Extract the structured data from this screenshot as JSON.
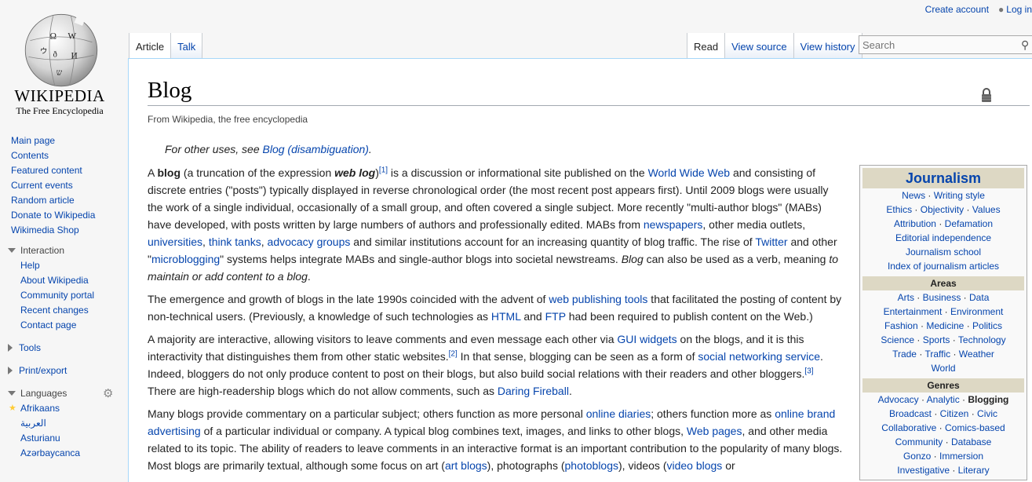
{
  "logo": {
    "wordmark": "WIKIPEDIA",
    "tagline": "The Free Encyclopedia"
  },
  "personal": {
    "create_account": "Create account",
    "login": "Log in"
  },
  "nav": {
    "main": [
      "Main page",
      "Contents",
      "Featured content",
      "Current events",
      "Random article",
      "Donate to Wikipedia",
      "Wikimedia Shop"
    ],
    "interaction_label": "Interaction",
    "interaction": [
      "Help",
      "About Wikipedia",
      "Community portal",
      "Recent changes",
      "Contact page"
    ],
    "tools_label": "Tools",
    "print_label": "Print/export",
    "languages_label": "Languages",
    "languages": [
      "Afrikaans",
      "العربية",
      "Asturianu",
      "Azərbaycanca"
    ]
  },
  "tabs": {
    "article": "Article",
    "talk": "Talk",
    "read": "Read",
    "view_source": "View source",
    "view_history": "View history"
  },
  "search": {
    "placeholder": "Search"
  },
  "article": {
    "title": "Blog",
    "from": "From Wikipedia, the free encyclopedia",
    "hatnote_pre": "For other uses, see ",
    "hatnote_link": "Blog (disambiguation)",
    "hatnote_post": "."
  },
  "infobox": {
    "title": "Journalism",
    "rows1": [
      [
        "News",
        "Writing style"
      ],
      [
        "Ethics",
        "Objectivity",
        "Values"
      ],
      [
        "Attribution",
        "Defamation"
      ],
      [
        "Editorial independence"
      ],
      [
        "Journalism school"
      ],
      [
        "Index of journalism articles"
      ]
    ],
    "areas_label": "Areas",
    "rows2": [
      [
        "Arts",
        "Business",
        "Data"
      ],
      [
        "Entertainment",
        "Environment"
      ],
      [
        "Fashion",
        "Medicine",
        "Politics"
      ],
      [
        "Science",
        "Sports",
        "Technology"
      ],
      [
        "Trade",
        "Traffic",
        "Weather"
      ],
      [
        "World"
      ]
    ],
    "genres_label": "Genres",
    "rows3": [
      [
        "Advocacy",
        "Analytic",
        "Blogging"
      ],
      [
        "Broadcast",
        "Citizen",
        "Civic"
      ],
      [
        "Collaborative",
        "Comics-based"
      ],
      [
        "Community",
        "Database"
      ],
      [
        "Gonzo",
        "Immersion"
      ],
      [
        "Investigative",
        "Literary"
      ]
    ],
    "current": "Blogging"
  },
  "paragraphs": [
    [
      {
        "t": "A "
      },
      {
        "t": "blog",
        "b": true
      },
      {
        "t": " (a truncation of the expression "
      },
      {
        "t": "web log",
        "b": true,
        "i": true
      },
      {
        "t": ")"
      },
      {
        "t": "[1]",
        "sup": true,
        "link": true
      },
      {
        "t": " is a discussion or informational site published on the "
      },
      {
        "t": "World Wide Web",
        "link": true
      },
      {
        "t": " and consisting of discrete entries (\"posts\") typically displayed in reverse chronological order (the most recent post appears first). Until 2009 blogs were usually the work of a single individual, occasionally of a small group, and often covered a single subject. More recently \"multi-author blogs\" (MABs) have developed, with posts written by large numbers of authors and professionally edited. MABs from "
      },
      {
        "t": "newspapers",
        "link": true
      },
      {
        "t": ", other media outlets, "
      },
      {
        "t": "universities",
        "link": true
      },
      {
        "t": ", "
      },
      {
        "t": "think tanks",
        "link": true
      },
      {
        "t": ", "
      },
      {
        "t": "advocacy groups",
        "link": true
      },
      {
        "t": " and similar institutions account for an increasing quantity of blog traffic. The rise of "
      },
      {
        "t": "Twitter",
        "link": true
      },
      {
        "t": " and other \""
      },
      {
        "t": "microblogging",
        "link": true
      },
      {
        "t": "\" systems helps integrate MABs and single-author blogs into societal newstreams. "
      },
      {
        "t": "Blog",
        "i": true
      },
      {
        "t": " can also be used as a verb, meaning "
      },
      {
        "t": "to maintain or add content to a blog",
        "i": true
      },
      {
        "t": "."
      }
    ],
    [
      {
        "t": "The emergence and growth of blogs in the late 1990s coincided with the advent of "
      },
      {
        "t": "web publishing tools",
        "link": true
      },
      {
        "t": " that facilitated the posting of content by non-technical users. (Previously, a knowledge of such technologies as "
      },
      {
        "t": "HTML",
        "link": true
      },
      {
        "t": " and "
      },
      {
        "t": "FTP",
        "link": true
      },
      {
        "t": " had been required to publish content on the Web.)"
      }
    ],
    [
      {
        "t": "A majority are interactive, allowing visitors to leave comments and even message each other via "
      },
      {
        "t": "GUI widgets",
        "link": true
      },
      {
        "t": " on the blogs, and it is this interactivity that distinguishes them from other static websites."
      },
      {
        "t": "[2]",
        "sup": true,
        "link": true
      },
      {
        "t": " In that sense, blogging can be seen as a form of "
      },
      {
        "t": "social networking service",
        "link": true
      },
      {
        "t": ". Indeed, bloggers do not only produce content to post on their blogs, but also build social relations with their readers and other bloggers."
      },
      {
        "t": "[3]",
        "sup": true,
        "link": true
      },
      {
        "t": " There are high-readership blogs which do not allow comments, such as "
      },
      {
        "t": "Daring Fireball",
        "link": true
      },
      {
        "t": "."
      }
    ],
    [
      {
        "t": "Many blogs provide commentary on a particular subject; others function as more personal "
      },
      {
        "t": "online diaries",
        "link": true
      },
      {
        "t": "; others function more as "
      },
      {
        "t": "online brand advertising",
        "link": true
      },
      {
        "t": " of a particular individual or company. A typical blog combines text, images, and links to other blogs, "
      },
      {
        "t": "Web pages",
        "link": true
      },
      {
        "t": ", and other media related to its topic. The ability of readers to leave comments in an interactive format is an important contribution to the popularity of many blogs. Most blogs are primarily textual, although some focus on art ("
      },
      {
        "t": "art blogs",
        "link": true
      },
      {
        "t": "), photographs ("
      },
      {
        "t": "photoblogs",
        "link": true
      },
      {
        "t": "), videos ("
      },
      {
        "t": "video blogs",
        "link": true
      },
      {
        "t": " or"
      }
    ]
  ]
}
